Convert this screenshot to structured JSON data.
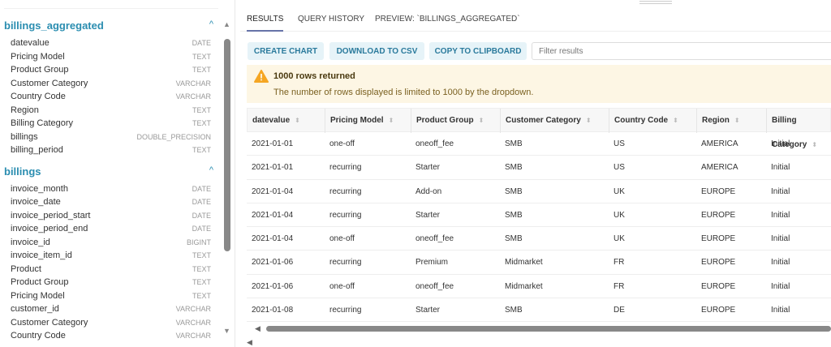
{
  "sidebar": {
    "sections": [
      {
        "title": "billings_aggregated",
        "columns": [
          {
            "name": "datevalue",
            "type": "DATE"
          },
          {
            "name": "Pricing Model",
            "type": "TEXT"
          },
          {
            "name": "Product Group",
            "type": "TEXT"
          },
          {
            "name": "Customer Category",
            "type": "VARCHAR"
          },
          {
            "name": "Country Code",
            "type": "VARCHAR"
          },
          {
            "name": "Region",
            "type": "TEXT"
          },
          {
            "name": "Billing Category",
            "type": "TEXT"
          },
          {
            "name": "billings",
            "type": "DOUBLE_PRECISION"
          },
          {
            "name": "billing_period",
            "type": "TEXT"
          }
        ]
      },
      {
        "title": "billings",
        "columns": [
          {
            "name": "invoice_month",
            "type": "DATE"
          },
          {
            "name": "invoice_date",
            "type": "DATE"
          },
          {
            "name": "invoice_period_start",
            "type": "DATE"
          },
          {
            "name": "invoice_period_end",
            "type": "DATE"
          },
          {
            "name": "invoice_id",
            "type": "BIGINT"
          },
          {
            "name": "invoice_item_id",
            "type": "TEXT"
          },
          {
            "name": "Product",
            "type": "TEXT"
          },
          {
            "name": "Product Group",
            "type": "TEXT"
          },
          {
            "name": "Pricing Model",
            "type": "TEXT"
          },
          {
            "name": "customer_id",
            "type": "VARCHAR"
          },
          {
            "name": "Customer Category",
            "type": "VARCHAR"
          },
          {
            "name": "Country Code",
            "type": "VARCHAR"
          }
        ]
      }
    ]
  },
  "tabs": [
    "RESULTS",
    "QUERY HISTORY",
    "PREVIEW: `BILLINGS_AGGREGATED`"
  ],
  "toolbar": {
    "create_chart": "CREATE CHART",
    "download_csv": "DOWNLOAD TO CSV",
    "copy_clipboard": "COPY TO CLIPBOARD",
    "filter_placeholder": "Filter results"
  },
  "alert": {
    "title": "1000 rows returned",
    "message": "The number of rows displayed is limited to 1000 by the dropdown.",
    "color": "#f5a623"
  },
  "table": {
    "headers": [
      "datevalue",
      "Pricing Model",
      "Product Group",
      "Customer Category",
      "Country Code",
      "Region",
      "Billing Category"
    ],
    "rows": [
      [
        "2021-01-01",
        "one-off",
        "oneoff_fee",
        "SMB",
        "US",
        "AMERICA",
        "Initial"
      ],
      [
        "2021-01-01",
        "recurring",
        "Starter",
        "SMB",
        "US",
        "AMERICA",
        "Initial"
      ],
      [
        "2021-01-04",
        "recurring",
        "Add-on",
        "SMB",
        "UK",
        "EUROPE",
        "Initial"
      ],
      [
        "2021-01-04",
        "recurring",
        "Starter",
        "SMB",
        "UK",
        "EUROPE",
        "Initial"
      ],
      [
        "2021-01-04",
        "one-off",
        "oneoff_fee",
        "SMB",
        "UK",
        "EUROPE",
        "Initial"
      ],
      [
        "2021-01-06",
        "recurring",
        "Premium",
        "Midmarket",
        "FR",
        "EUROPE",
        "Initial"
      ],
      [
        "2021-01-06",
        "one-off",
        "oneoff_fee",
        "Midmarket",
        "FR",
        "EUROPE",
        "Initial"
      ],
      [
        "2021-01-08",
        "recurring",
        "Starter",
        "SMB",
        "DE",
        "EUROPE",
        "Initial"
      ]
    ]
  }
}
